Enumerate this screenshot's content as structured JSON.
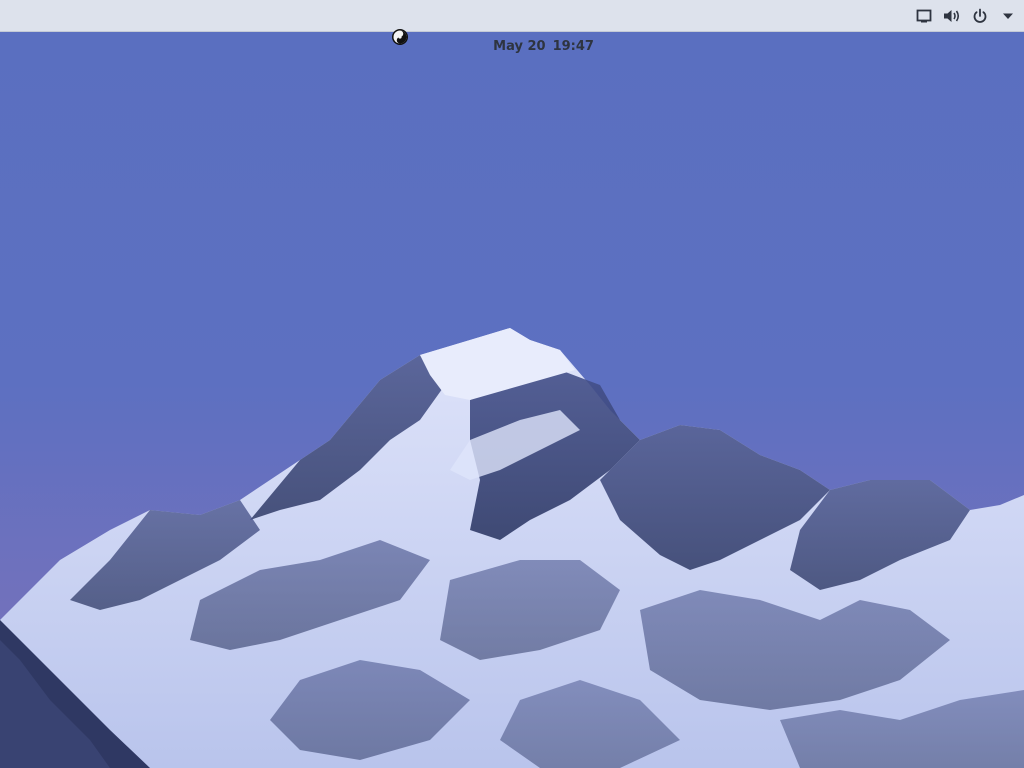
{
  "topbar": {
    "date": "May 20",
    "time": "19:47"
  },
  "tray": {
    "icons": [
      "screen-icon",
      "volume-icon",
      "power-icon",
      "menu-arrow-icon"
    ]
  },
  "wallpaper": {
    "subject": "mountain",
    "sky_color_top": "#5a6fc0",
    "sky_color_bottom": "#7a72b8",
    "snow_color": "#c9d2f0",
    "rock_color": "#3a4570"
  },
  "colors": {
    "topbar_bg": "#dde2ec",
    "topbar_text": "#2e3440"
  }
}
